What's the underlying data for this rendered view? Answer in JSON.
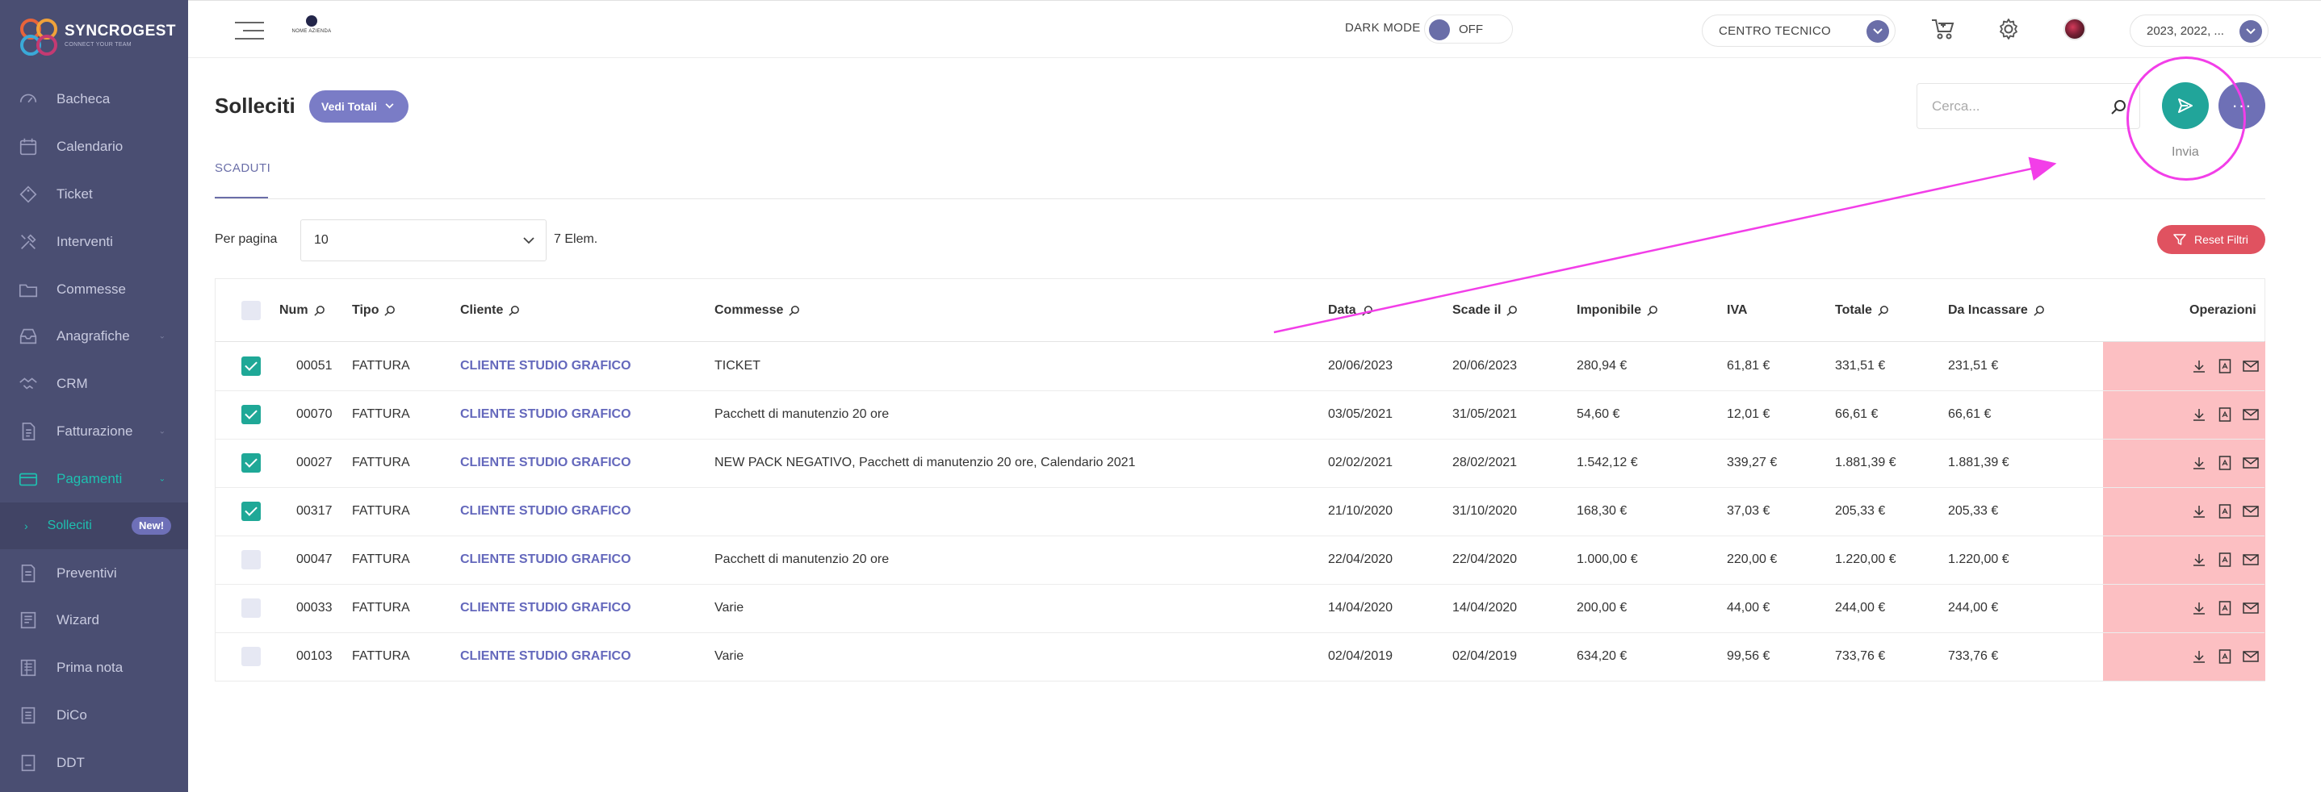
{
  "brand": {
    "name": "SYNCROGEST",
    "tagline": "CONNECT YOUR TEAM"
  },
  "sidebar": {
    "items": [
      {
        "label": "Bacheca",
        "icon": "dashboard-icon",
        "has_caret": false
      },
      {
        "label": "Calendario",
        "icon": "calendar-icon",
        "has_caret": false
      },
      {
        "label": "Ticket",
        "icon": "ticket-icon",
        "has_caret": false
      },
      {
        "label": "Interventi",
        "icon": "tools-icon",
        "has_caret": false
      },
      {
        "label": "Commesse",
        "icon": "folder-icon",
        "has_caret": false
      },
      {
        "label": "Anagrafiche",
        "icon": "inbox-icon",
        "has_caret": true
      },
      {
        "label": "CRM",
        "icon": "handshake-icon",
        "has_caret": false
      },
      {
        "label": "Fatturazione",
        "icon": "invoice-icon",
        "has_caret": true
      },
      {
        "label": "Pagamenti",
        "icon": "payment-icon",
        "has_caret": true,
        "active": true
      },
      {
        "label": "Preventivi",
        "icon": "quote-icon",
        "has_caret": false
      },
      {
        "label": "Wizard",
        "icon": "wizard-icon",
        "has_caret": false
      },
      {
        "label": "Prima nota",
        "icon": "ledger-icon",
        "has_caret": false
      },
      {
        "label": "DiCo",
        "icon": "document-icon",
        "has_caret": false
      },
      {
        "label": "DDT",
        "icon": "ddt-icon",
        "has_caret": false
      }
    ],
    "sub_item": {
      "label": "Solleciti",
      "badge": "New!"
    }
  },
  "topbar": {
    "company_name": "NOME AZIENDA",
    "dark_mode_label": "DARK MODE",
    "dark_mode_state": "OFF",
    "centro_value": "CENTRO TECNICO",
    "year_value": "2023, 2022, ..."
  },
  "page": {
    "title": "Solleciti",
    "totals_button": "Vedi Totali",
    "search_placeholder": "Cerca...",
    "send_caption": "Invia",
    "more_label": "···",
    "tab_label": "SCADUTI",
    "per_page_label": "Per pagina",
    "per_page_value": "10",
    "elem_count": "7 Elem.",
    "reset_label": "Reset Filtri"
  },
  "table": {
    "headers": {
      "num": "Num",
      "tipo": "Tipo",
      "cliente": "Cliente",
      "commesse": "Commesse",
      "data": "Data",
      "scade": "Scade il",
      "imponibile": "Imponibile",
      "iva": "IVA",
      "totale": "Totale",
      "incassare": "Da Incassare",
      "operazioni": "Operazioni"
    },
    "rows": [
      {
        "checked": true,
        "num": "00051",
        "tipo": "FATTURA",
        "cliente": "CLIENTE STUDIO GRAFICO",
        "commesse": "TICKET",
        "data": "20/06/2023",
        "scade": "20/06/2023",
        "imponibile": "280,94 €",
        "iva": "61,81 €",
        "totale": "331,51 €",
        "incassare": "231,51 €"
      },
      {
        "checked": true,
        "num": "00070",
        "tipo": "FATTURA",
        "cliente": "CLIENTE STUDIO GRAFICO",
        "commesse": "Pacchett di manutenzio 20 ore",
        "data": "03/05/2021",
        "scade": "31/05/2021",
        "imponibile": "54,60 €",
        "iva": "12,01 €",
        "totale": "66,61 €",
        "incassare": "66,61 €"
      },
      {
        "checked": true,
        "num": "00027",
        "tipo": "FATTURA",
        "cliente": "CLIENTE STUDIO GRAFICO",
        "commesse": "NEW PACK NEGATIVO, Pacchett di manutenzio 20 ore, Calendario 2021",
        "data": "02/02/2021",
        "scade": "28/02/2021",
        "imponibile": "1.542,12 €",
        "iva": "339,27 €",
        "totale": "1.881,39 €",
        "incassare": "1.881,39 €"
      },
      {
        "checked": true,
        "num": "00317",
        "tipo": "FATTURA",
        "cliente": "CLIENTE STUDIO GRAFICO",
        "commesse": "",
        "data": "21/10/2020",
        "scade": "31/10/2020",
        "imponibile": "168,30 €",
        "iva": "37,03 €",
        "totale": "205,33 €",
        "incassare": "205,33 €"
      },
      {
        "checked": false,
        "num": "00047",
        "tipo": "FATTURA",
        "cliente": "CLIENTE STUDIO GRAFICO",
        "commesse": "Pacchett di manutenzio 20 ore",
        "data": "22/04/2020",
        "scade": "22/04/2020",
        "imponibile": "1.000,00 €",
        "iva": "220,00 €",
        "totale": "1.220,00 €",
        "incassare": "1.220,00 €"
      },
      {
        "checked": false,
        "num": "00033",
        "tipo": "FATTURA",
        "cliente": "CLIENTE STUDIO GRAFICO",
        "commesse": "Varie",
        "data": "14/04/2020",
        "scade": "14/04/2020",
        "imponibile": "200,00 €",
        "iva": "44,00 €",
        "totale": "244,00 €",
        "incassare": "244,00 €"
      },
      {
        "checked": false,
        "num": "00103",
        "tipo": "FATTURA",
        "cliente": "CLIENTE STUDIO GRAFICO",
        "commesse": "Varie",
        "data": "02/04/2019",
        "scade": "02/04/2019",
        "imponibile": "634,20 €",
        "iva": "99,56 €",
        "totale": "733,76 €",
        "incassare": "733,76 €"
      }
    ]
  },
  "colors": {
    "sidebar_bg": "#4a4e72",
    "accent_teal": "#1ec0b0",
    "accent_purple": "#6a6ea8",
    "reset_red": "#e05260",
    "operations_bg": "#fcbfc2",
    "annotation_magenta": "#f23ee8"
  }
}
